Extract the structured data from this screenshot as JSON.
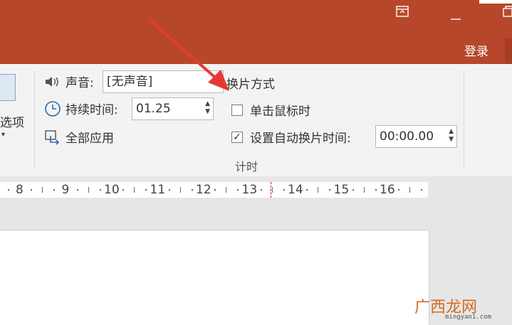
{
  "titlebar": {
    "login_label": "登录",
    "ribbon_display_icon": "ribbon-display-options-icon",
    "minimize_icon": "minimize-icon",
    "restore_icon": "restore-icon",
    "color": "#b7472a"
  },
  "ribbon": {
    "effect_options_label": "选项",
    "sound": {
      "label": "声音:",
      "value": "[无声音]"
    },
    "duration": {
      "label": "持续时间:",
      "value": "01.25"
    },
    "apply_all_label": "全部应用",
    "advance_title": "换片方式",
    "on_click": {
      "label": "单击鼠标时",
      "checked": false
    },
    "after": {
      "label": "设置自动换片时间:",
      "checked": true,
      "value": "00:00.00"
    },
    "group_label": "计时"
  },
  "ruler": {
    "numbers": [
      "8",
      "9",
      "10",
      "11",
      "12",
      "13",
      "14",
      "15",
      "16"
    ]
  },
  "watermark": {
    "text": "广西龙网",
    "url": "mingyan1.com"
  },
  "colors": {
    "accent": "#b7472a",
    "arrow": "#e53935",
    "watermark": "#d36b1e"
  }
}
